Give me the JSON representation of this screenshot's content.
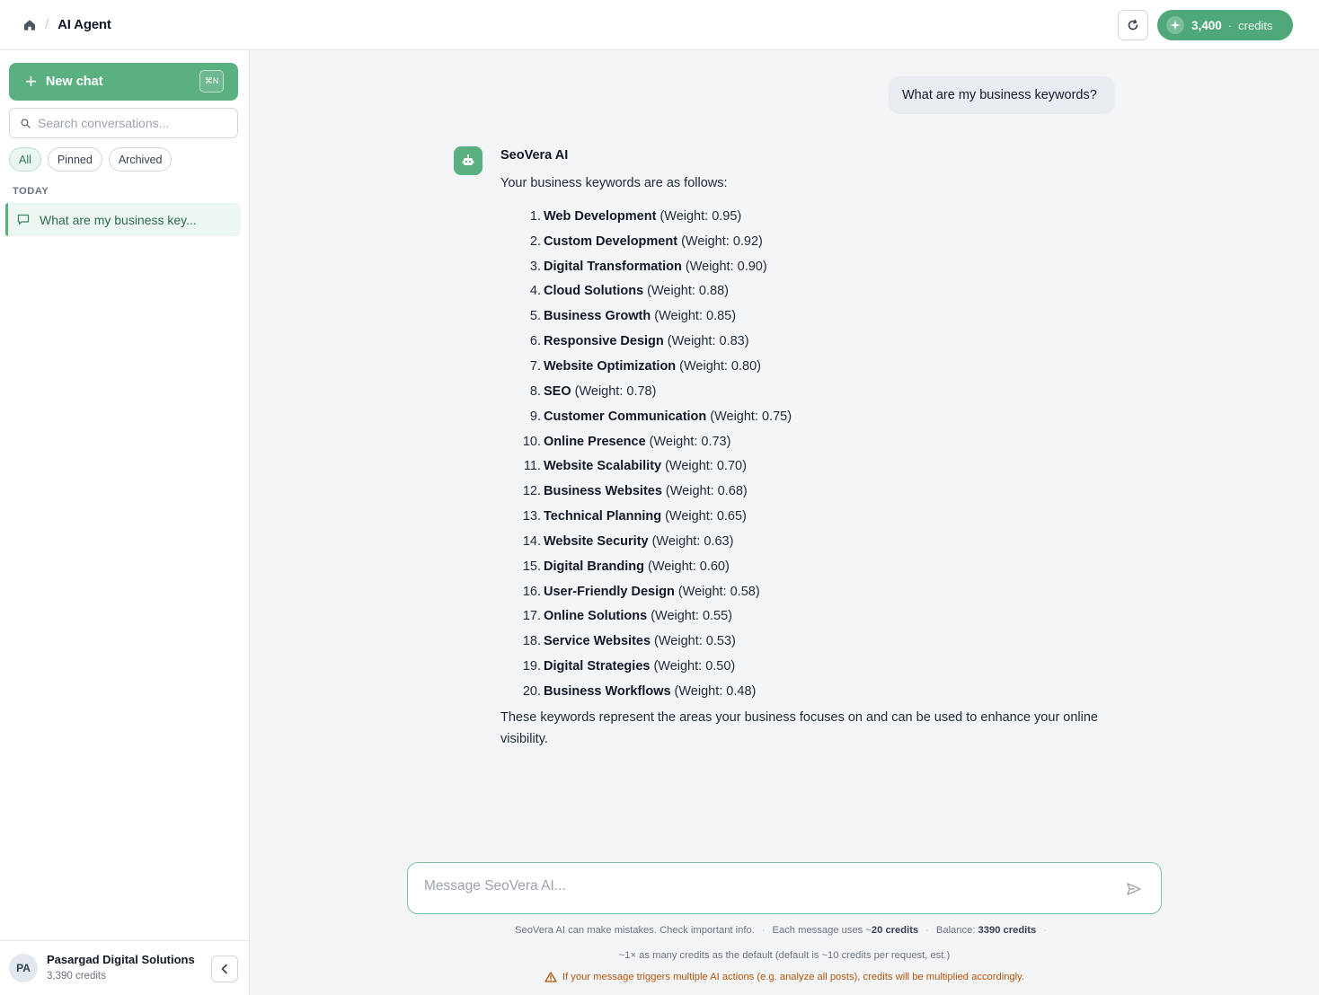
{
  "header": {
    "title": "AI Agent",
    "crumb_separator": "/",
    "credits_amount": "3,400",
    "credits_separator": "·",
    "credits_label": "credits"
  },
  "sidebar": {
    "new_chat_label": "New chat",
    "new_chat_shortcut": "⌘N",
    "search_placeholder": "Search conversations...",
    "filters": [
      {
        "label": "All",
        "active": true
      },
      {
        "label": "Pinned",
        "active": false
      },
      {
        "label": "Archived",
        "active": false
      }
    ],
    "section_label": "TODAY",
    "conversations": [
      {
        "title": "What are my business key..."
      }
    ],
    "footer": {
      "avatar_initials": "PA",
      "org_name": "Pasargad Digital Solutions",
      "org_credits": "3,390 credits"
    }
  },
  "chat": {
    "user_message": "What are my business keywords?",
    "bot_name": "SeoVera AI",
    "bot_intro": "Your business keywords are as follows:",
    "keywords": [
      {
        "num": "1.",
        "name": "Web Development",
        "weight": "(Weight: 0.95)"
      },
      {
        "num": "2.",
        "name": "Custom Development",
        "weight": "(Weight: 0.92)"
      },
      {
        "num": "3.",
        "name": "Digital Transformation",
        "weight": "(Weight: 0.90)"
      },
      {
        "num": "4.",
        "name": "Cloud Solutions",
        "weight": "(Weight: 0.88)"
      },
      {
        "num": "5.",
        "name": "Business Growth",
        "weight": "(Weight: 0.85)"
      },
      {
        "num": "6.",
        "name": "Responsive Design",
        "weight": "(Weight: 0.83)"
      },
      {
        "num": "7.",
        "name": "Website Optimization",
        "weight": "(Weight: 0.80)"
      },
      {
        "num": "8.",
        "name": "SEO",
        "weight": "(Weight: 0.78)"
      },
      {
        "num": "9.",
        "name": "Customer Communication",
        "weight": "(Weight: 0.75)"
      },
      {
        "num": "10.",
        "name": "Online Presence",
        "weight": "(Weight: 0.73)"
      },
      {
        "num": "11.",
        "name": "Website Scalability",
        "weight": "(Weight: 0.70)"
      },
      {
        "num": "12.",
        "name": "Business Websites",
        "weight": "(Weight: 0.68)"
      },
      {
        "num": "13.",
        "name": "Technical Planning",
        "weight": "(Weight: 0.65)"
      },
      {
        "num": "14.",
        "name": "Website Security",
        "weight": "(Weight: 0.63)"
      },
      {
        "num": "15.",
        "name": "Digital Branding",
        "weight": "(Weight: 0.60)"
      },
      {
        "num": "16.",
        "name": "User-Friendly Design",
        "weight": "(Weight: 0.58)"
      },
      {
        "num": "17.",
        "name": "Online Solutions",
        "weight": "(Weight: 0.55)"
      },
      {
        "num": "18.",
        "name": "Service Websites",
        "weight": "(Weight: 0.53)"
      },
      {
        "num": "19.",
        "name": "Digital Strategies",
        "weight": "(Weight: 0.50)"
      },
      {
        "num": "20.",
        "name": "Business Workflows",
        "weight": "(Weight: 0.48)"
      }
    ],
    "bot_outro": "These keywords represent the areas your business focuses on and can be used to enhance your online visibility."
  },
  "composer": {
    "placeholder": "Message SeoVera AI...",
    "disclaimer_mistakes": "SeoVera AI can make mistakes. Check important info.",
    "separator": "·",
    "disclaimer_cost_prefix": "Each message uses ~",
    "disclaimer_cost_value": "20 credits",
    "disclaimer_balance_prefix": "Balance:",
    "disclaimer_balance_value": "3390 credits",
    "multiplier_note": "~1× as many credits as the default (default is ~10 credits per request, est.)",
    "warning_note": "If your message triggers multiple AI actions (e.g. analyze all posts), credits will be multiplied accordingly."
  },
  "colors": {
    "accent": "#5bb082",
    "accent_dark": "#4fa87a",
    "warning": "#b45309"
  },
  "icons": [
    "home-icon",
    "refresh-icon",
    "sparkle-icon",
    "plus-icon",
    "search-icon",
    "chat-bubble-icon",
    "chevron-left-icon",
    "robot-icon",
    "send-icon",
    "warning-icon"
  ]
}
